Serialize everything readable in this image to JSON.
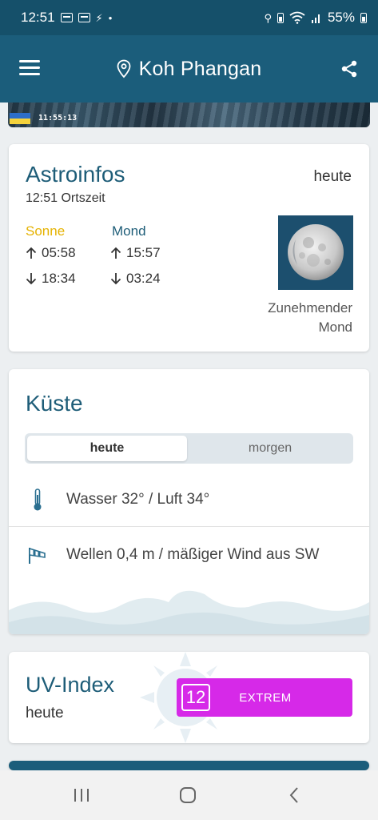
{
  "status_bar": {
    "time": "12:51",
    "battery": "55%",
    "dot": "•"
  },
  "app_bar": {
    "title": "Koh Phangan"
  },
  "webcam": {
    "timestamp": "11:55:13"
  },
  "astro": {
    "title": "Astroinfos",
    "local_time": "12:51 Ortszeit",
    "day": "heute",
    "sun": {
      "label": "Sonne",
      "rise": "05:58",
      "set": "18:34"
    },
    "moon": {
      "label": "Mond",
      "rise": "15:57",
      "set": "03:24",
      "phase_line1": "Zunehmender",
      "phase_line2": "Mond"
    }
  },
  "coast": {
    "title": "Küste",
    "tabs": [
      "heute",
      "morgen"
    ],
    "temperature": "Wasser 32° / Luft 34°",
    "waves": "Wellen 0,4 m / mäßiger Wind aus SW"
  },
  "uv": {
    "title": "UV-Index",
    "day": "heute",
    "value": "12",
    "level": "EXTREM"
  },
  "colors": {
    "app_bar": "#1b5d7b",
    "status_bar": "#15506a",
    "accent_text": "#1e5d78",
    "sun": "#e5b200",
    "uv_extreme": "#d629e8"
  },
  "icons": [
    "menu-icon",
    "location-pin-icon",
    "share-icon",
    "arrow-up-icon",
    "arrow-down-icon",
    "thermometer-icon",
    "windsock-icon",
    "moon-icon",
    "recents-icon",
    "home-icon",
    "back-icon"
  ]
}
